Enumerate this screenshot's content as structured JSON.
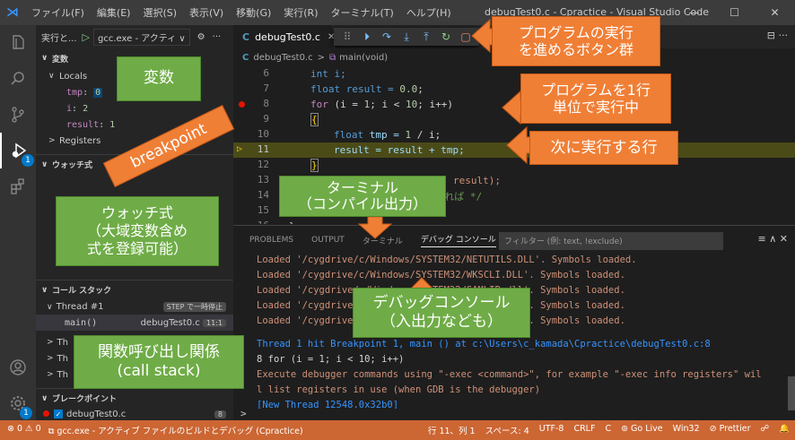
{
  "window": {
    "title": "debugTest0.c - Cpractice - Visual Studio Code",
    "logo": "⋊",
    "menu": [
      "ファイル(F)",
      "編集(E)",
      "選択(S)",
      "表示(V)",
      "移動(G)",
      "実行(R)",
      "ターミナル(T)",
      "ヘルプ(H)"
    ],
    "controls": {
      "minimize": "—",
      "maximize": "☐",
      "close": "✕"
    }
  },
  "activity_bar": {
    "icons": [
      "explorer-icon",
      "search-icon",
      "source-control-icon",
      "run-debug-icon",
      "extensions-icon",
      "account-icon",
      "manage-gear-icon"
    ],
    "debug_badge": "1",
    "manage_badge": "1"
  },
  "sidebar": {
    "run_label": "実行と...",
    "config": "gcc.exe - アクティ",
    "config_chevron": "∨",
    "variables_header": "変数",
    "locals_label": "Locals",
    "locals": [
      {
        "name": "tmp",
        "value": "0"
      },
      {
        "name": "i",
        "value": "2"
      },
      {
        "name": "result",
        "value": "1"
      }
    ],
    "registers_label": "Registers",
    "watch_header": "ウォッチ式",
    "callstack_header": "コール スタック",
    "thread_main": "Thread #1",
    "thread_status": "STEP で一時停止",
    "frame_fn": "main()",
    "frame_file": "debugTest0.c",
    "frame_pos": "11:1",
    "other_threads": [
      "Th",
      "Th",
      "Th"
    ],
    "breakpoints_header": "ブレークポイント",
    "breakpoint_file": "debugTest0.c",
    "breakpoint_count": "8"
  },
  "editor": {
    "tab_label": "debugTest0.c",
    "tab_lang": "C",
    "tab_close": "✕",
    "breadcrumb_file": "debugTest0.c",
    "breadcrumb_fn": "main(void)",
    "debug_toolbar": [
      "⠿",
      "⏵",
      "↷",
      "⤓",
      "⤒",
      "↻",
      "▢"
    ],
    "editor_actions": "⊟  ···",
    "current_line": "11",
    "breakpoint_line": "8",
    "line_numbers": [
      "6",
      "7",
      "8",
      "9",
      "10",
      "11",
      "12",
      "13",
      "14",
      "15",
      "16"
    ],
    "lines": {
      "l6": "int i;",
      "l7a": "float result = ",
      "l7b": "0.0",
      "l8a": "for",
      "l8b": " (i = ",
      "l8c": "1",
      "l8d": "; i < ",
      "l8e": "10",
      "l8f": "; i++)",
      "l9": "{",
      "l10a": "float",
      "l10b": " tmp = ",
      "l10c": "1",
      "l10d": " / i;",
      "l11": "result = result + tmp;",
      "l12": "}",
      "l13a": "printf",
      "l13b": "(\"result = %f\\n\", result);",
      "l14": "// ...で、出力を強制したければ */",
      "l15": "",
      "l16": "}"
    }
  },
  "panel": {
    "tabs": [
      "PROBLEMS",
      "OUTPUT",
      "ターミナル",
      "デバッグ コンソール"
    ],
    "filter_placeholder": "フィルター (例: text, !exclude)",
    "actions": "≡  ∧  ✕",
    "console_lines": [
      "Loaded '/cygdrive/c/Windows/SYSTEM32/NETUTILS.DLL'. Symbols loaded.",
      "Loaded '/cygdrive/c/Windows/SYSTEM32/WKSCLI.DLL'. Symbols loaded.",
      "Loaded '/cygdrive/c/Windows/SYSTEM32/SAMLIB.dll'. Symbols loaded.",
      "Loaded '/cygdrive/c/Windows/SYSTEM32/..........'. Symbols loaded.",
      "Loaded '/cygdrive/c/Windows/SYSTEM32/..........'. Symbols loaded."
    ],
    "hit_line": "Thread 1 hit Breakpoint 1, main () at c:\\Users\\c_kamada\\Cpractice\\debugTest0.c:8",
    "hit_code": "8           for (i = 1; i < 10; i++)",
    "exec_line1": "Execute debugger commands using \"-exec <command>\", for example \"-exec info registers\" wil",
    "exec_line2": "l list registers in use (when GDB is the debugger)",
    "new_thread": "[New Thread 12548.0x32b0]",
    "prompt": ">"
  },
  "statusbar": {
    "problems": "⊗ 0 ⚠ 0",
    "debug_config": "⧉ gcc.exe - アクティブ ファイルのビルドとデバッグ (Cpractice)",
    "right": [
      "行 11、列 1",
      "スペース: 4",
      "UTF-8",
      "CRLF",
      "C",
      "⊚ Go Live",
      "Win32",
      "⊘ Prettier",
      "☍",
      "🔔"
    ]
  },
  "annotations": {
    "program_buttons": "プログラムの実行\nを進めるボタン群",
    "variables": "変数",
    "step_one": "プログラムを1行\n単位で実行中",
    "breakpoint": "breakpoint",
    "next_line": "次に実行する行",
    "terminal": "ターミナル\n（コンパイル出力）",
    "watch": "ウォッチ式\n（大域変数含め\n式を登録可能）",
    "debug_console": "デバッグコンソール\n（入出力なども）",
    "call_stack": "関数呼び出し関係\n(call stack)"
  }
}
